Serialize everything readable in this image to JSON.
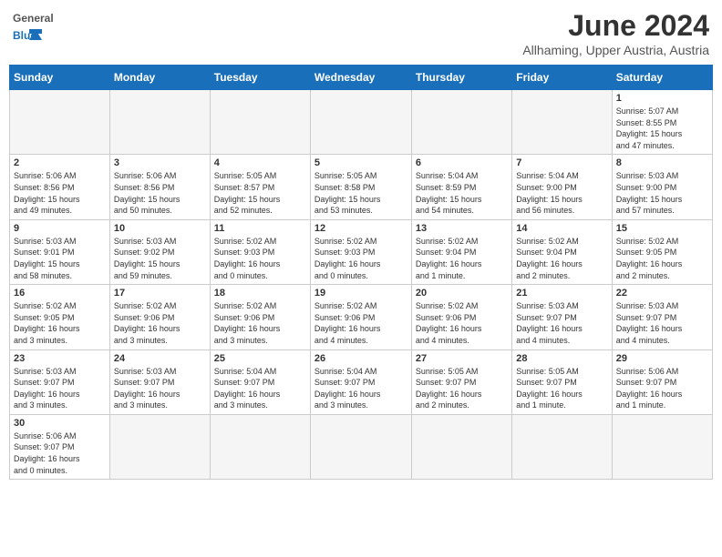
{
  "header": {
    "logo_general": "General",
    "logo_blue": "Blue",
    "month_year": "June 2024",
    "location": "Allhaming, Upper Austria, Austria"
  },
  "days_of_week": [
    "Sunday",
    "Monday",
    "Tuesday",
    "Wednesday",
    "Thursday",
    "Friday",
    "Saturday"
  ],
  "weeks": [
    [
      {
        "day": "",
        "info": ""
      },
      {
        "day": "",
        "info": ""
      },
      {
        "day": "",
        "info": ""
      },
      {
        "day": "",
        "info": ""
      },
      {
        "day": "",
        "info": ""
      },
      {
        "day": "",
        "info": ""
      },
      {
        "day": "1",
        "info": "Sunrise: 5:07 AM\nSunset: 8:55 PM\nDaylight: 15 hours\nand 47 minutes."
      }
    ],
    [
      {
        "day": "2",
        "info": "Sunrise: 5:06 AM\nSunset: 8:56 PM\nDaylight: 15 hours\nand 49 minutes."
      },
      {
        "day": "3",
        "info": "Sunrise: 5:06 AM\nSunset: 8:56 PM\nDaylight: 15 hours\nand 50 minutes."
      },
      {
        "day": "4",
        "info": "Sunrise: 5:05 AM\nSunset: 8:57 PM\nDaylight: 15 hours\nand 52 minutes."
      },
      {
        "day": "5",
        "info": "Sunrise: 5:05 AM\nSunset: 8:58 PM\nDaylight: 15 hours\nand 53 minutes."
      },
      {
        "day": "6",
        "info": "Sunrise: 5:04 AM\nSunset: 8:59 PM\nDaylight: 15 hours\nand 54 minutes."
      },
      {
        "day": "7",
        "info": "Sunrise: 5:04 AM\nSunset: 9:00 PM\nDaylight: 15 hours\nand 56 minutes."
      },
      {
        "day": "8",
        "info": "Sunrise: 5:03 AM\nSunset: 9:00 PM\nDaylight: 15 hours\nand 57 minutes."
      }
    ],
    [
      {
        "day": "9",
        "info": "Sunrise: 5:03 AM\nSunset: 9:01 PM\nDaylight: 15 hours\nand 58 minutes."
      },
      {
        "day": "10",
        "info": "Sunrise: 5:03 AM\nSunset: 9:02 PM\nDaylight: 15 hours\nand 59 minutes."
      },
      {
        "day": "11",
        "info": "Sunrise: 5:02 AM\nSunset: 9:03 PM\nDaylight: 16 hours\nand 0 minutes."
      },
      {
        "day": "12",
        "info": "Sunrise: 5:02 AM\nSunset: 9:03 PM\nDaylight: 16 hours\nand 0 minutes."
      },
      {
        "day": "13",
        "info": "Sunrise: 5:02 AM\nSunset: 9:04 PM\nDaylight: 16 hours\nand 1 minute."
      },
      {
        "day": "14",
        "info": "Sunrise: 5:02 AM\nSunset: 9:04 PM\nDaylight: 16 hours\nand 2 minutes."
      },
      {
        "day": "15",
        "info": "Sunrise: 5:02 AM\nSunset: 9:05 PM\nDaylight: 16 hours\nand 2 minutes."
      }
    ],
    [
      {
        "day": "16",
        "info": "Sunrise: 5:02 AM\nSunset: 9:05 PM\nDaylight: 16 hours\nand 3 minutes."
      },
      {
        "day": "17",
        "info": "Sunrise: 5:02 AM\nSunset: 9:06 PM\nDaylight: 16 hours\nand 3 minutes."
      },
      {
        "day": "18",
        "info": "Sunrise: 5:02 AM\nSunset: 9:06 PM\nDaylight: 16 hours\nand 3 minutes."
      },
      {
        "day": "19",
        "info": "Sunrise: 5:02 AM\nSunset: 9:06 PM\nDaylight: 16 hours\nand 4 minutes."
      },
      {
        "day": "20",
        "info": "Sunrise: 5:02 AM\nSunset: 9:06 PM\nDaylight: 16 hours\nand 4 minutes."
      },
      {
        "day": "21",
        "info": "Sunrise: 5:03 AM\nSunset: 9:07 PM\nDaylight: 16 hours\nand 4 minutes."
      },
      {
        "day": "22",
        "info": "Sunrise: 5:03 AM\nSunset: 9:07 PM\nDaylight: 16 hours\nand 4 minutes."
      }
    ],
    [
      {
        "day": "23",
        "info": "Sunrise: 5:03 AM\nSunset: 9:07 PM\nDaylight: 16 hours\nand 3 minutes."
      },
      {
        "day": "24",
        "info": "Sunrise: 5:03 AM\nSunset: 9:07 PM\nDaylight: 16 hours\nand 3 minutes."
      },
      {
        "day": "25",
        "info": "Sunrise: 5:04 AM\nSunset: 9:07 PM\nDaylight: 16 hours\nand 3 minutes."
      },
      {
        "day": "26",
        "info": "Sunrise: 5:04 AM\nSunset: 9:07 PM\nDaylight: 16 hours\nand 3 minutes."
      },
      {
        "day": "27",
        "info": "Sunrise: 5:05 AM\nSunset: 9:07 PM\nDaylight: 16 hours\nand 2 minutes."
      },
      {
        "day": "28",
        "info": "Sunrise: 5:05 AM\nSunset: 9:07 PM\nDaylight: 16 hours\nand 1 minute."
      },
      {
        "day": "29",
        "info": "Sunrise: 5:06 AM\nSunset: 9:07 PM\nDaylight: 16 hours\nand 1 minute."
      }
    ],
    [
      {
        "day": "30",
        "info": "Sunrise: 5:06 AM\nSunset: 9:07 PM\nDaylight: 16 hours\nand 0 minutes."
      },
      {
        "day": "",
        "info": ""
      },
      {
        "day": "",
        "info": ""
      },
      {
        "day": "",
        "info": ""
      },
      {
        "day": "",
        "info": ""
      },
      {
        "day": "",
        "info": ""
      },
      {
        "day": "",
        "info": ""
      }
    ]
  ]
}
